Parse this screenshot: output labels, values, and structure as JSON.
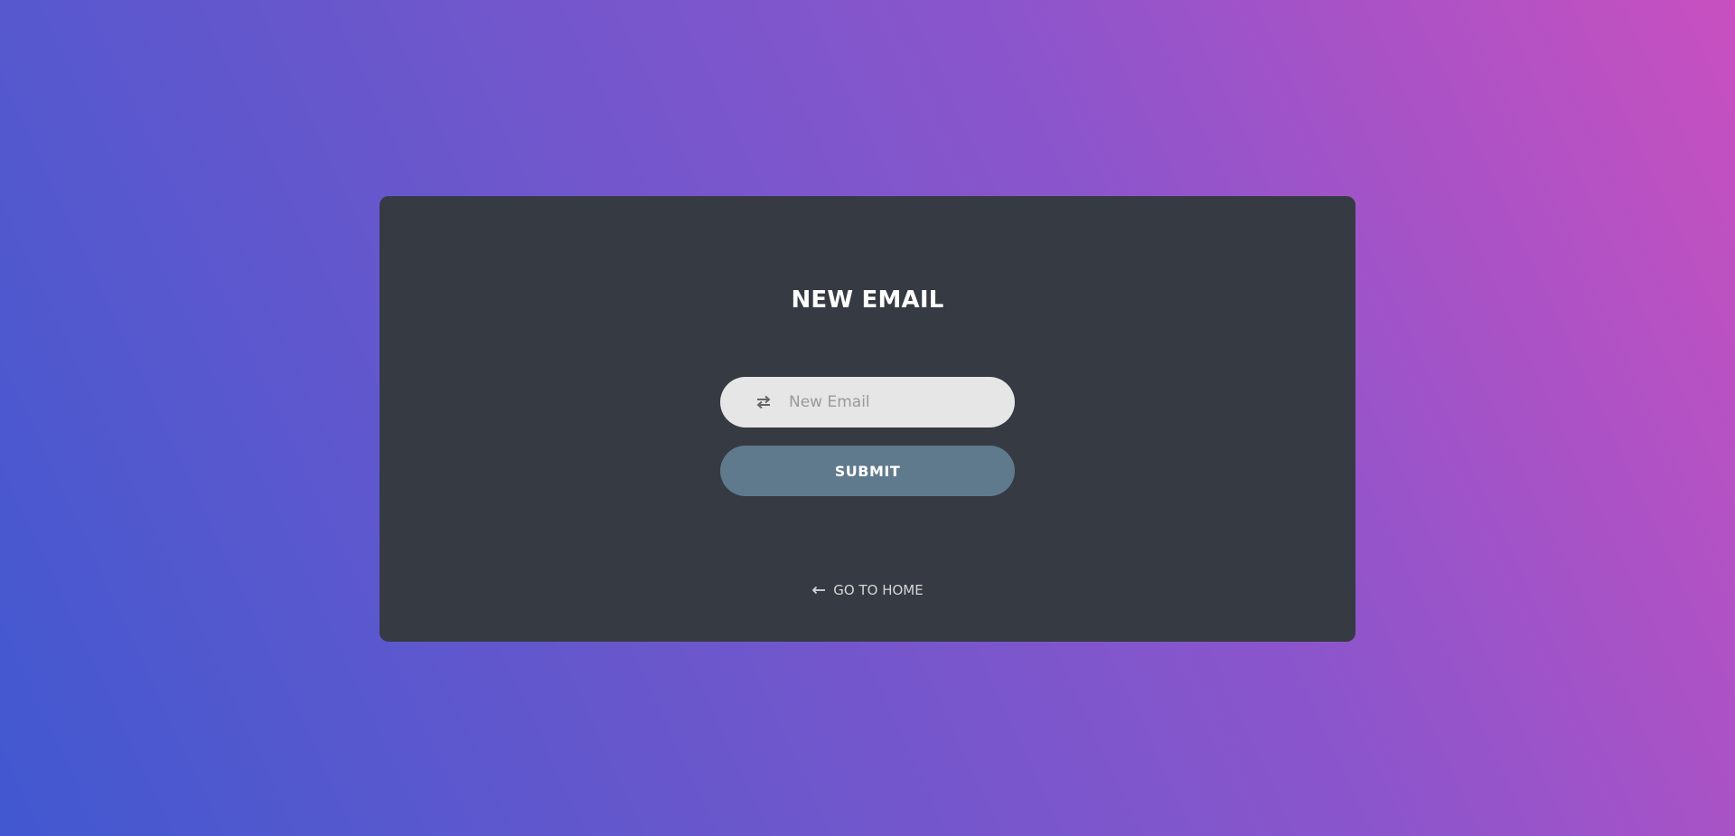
{
  "form": {
    "title": "NEW EMAIL",
    "email_input": {
      "placeholder": "New Email",
      "value": "",
      "icon": "exchange-arrows-icon"
    },
    "submit_label": "SUBMIT",
    "home_link": {
      "label": "GO TO HOME",
      "icon": "arrow-left-icon"
    }
  },
  "colors": {
    "gradient_start": "#c850c0",
    "gradient_end": "#4158d0",
    "card_background": "#363a42",
    "input_background": "#e6e6e6",
    "submit_background": "#5f7a8d",
    "title_text": "#ffffff",
    "link_text": "#d6d6d6"
  }
}
